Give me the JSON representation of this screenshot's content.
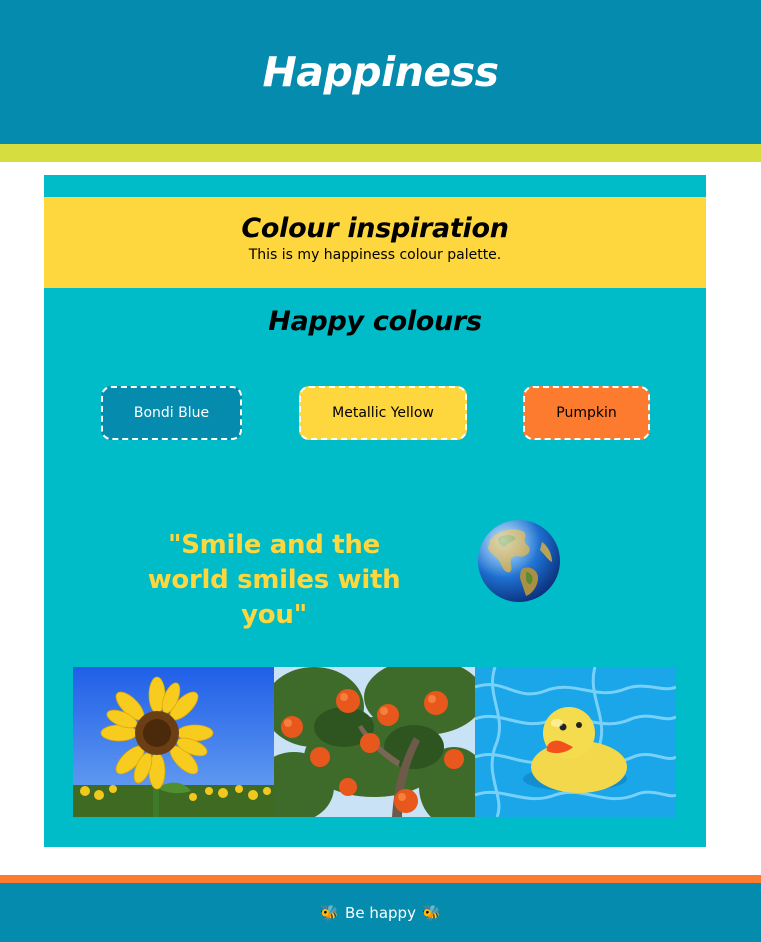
{
  "header": {
    "title": "Happiness"
  },
  "intro": {
    "title": "Colour inspiration",
    "text": "This is my happiness colour palette."
  },
  "colours": {
    "title": "Happy colours",
    "swatches": [
      {
        "label": "Bondi Blue",
        "color": "#048bae"
      },
      {
        "label": "Metallic Yellow",
        "color": "#fed73e"
      },
      {
        "label": "Pumpkin",
        "color": "#fd7b2f"
      }
    ]
  },
  "quote": {
    "text": "\"Smile and the world smiles with you\""
  },
  "photos": [
    "sunflower-photo",
    "orange-tree-photo",
    "rubber-duck-photo"
  ],
  "footer": {
    "text": "Be happy",
    "icon": "bee-icon"
  },
  "palette": {
    "header_bg": "#048bae",
    "stripe": "#d6dd3f",
    "panel_bg": "#00bcc8",
    "accent_yellow": "#fed73e",
    "accent_orange": "#fd7b2f"
  }
}
